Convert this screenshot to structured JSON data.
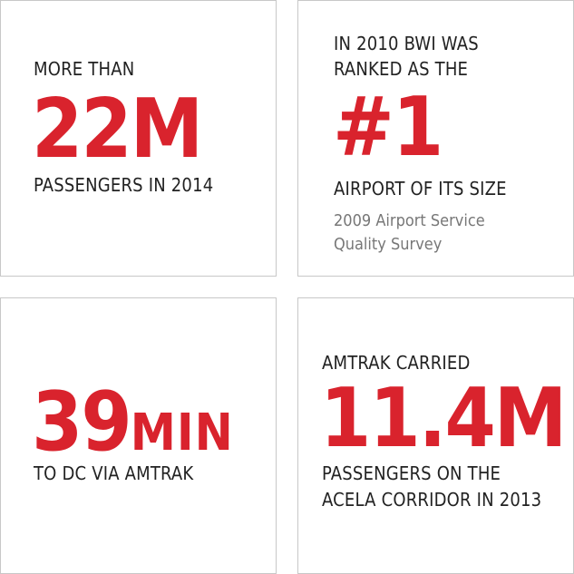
{
  "accent_color": "#d9232d",
  "stats": [
    {
      "lead": "MORE THAN",
      "value": "22M",
      "caption": "PASSENGERS IN 2014"
    },
    {
      "lead_line1": "IN 2010 BWI WAS",
      "lead_line2": "RANKED AS THE",
      "value": "#1",
      "caption": "AIRPORT OF ITS SIZE",
      "source_line1": "2009 Airport Service",
      "source_line2": "Quality Survey"
    },
    {
      "value_number": "39",
      "value_unit": "MIN",
      "caption": "TO DC VIA AMTRAK"
    },
    {
      "lead": "AMTRAK CARRIED",
      "value": "11.4M",
      "caption_line1": "PASSENGERS ON THE",
      "caption_line2": "ACELA CORRIDOR IN 2013"
    }
  ]
}
